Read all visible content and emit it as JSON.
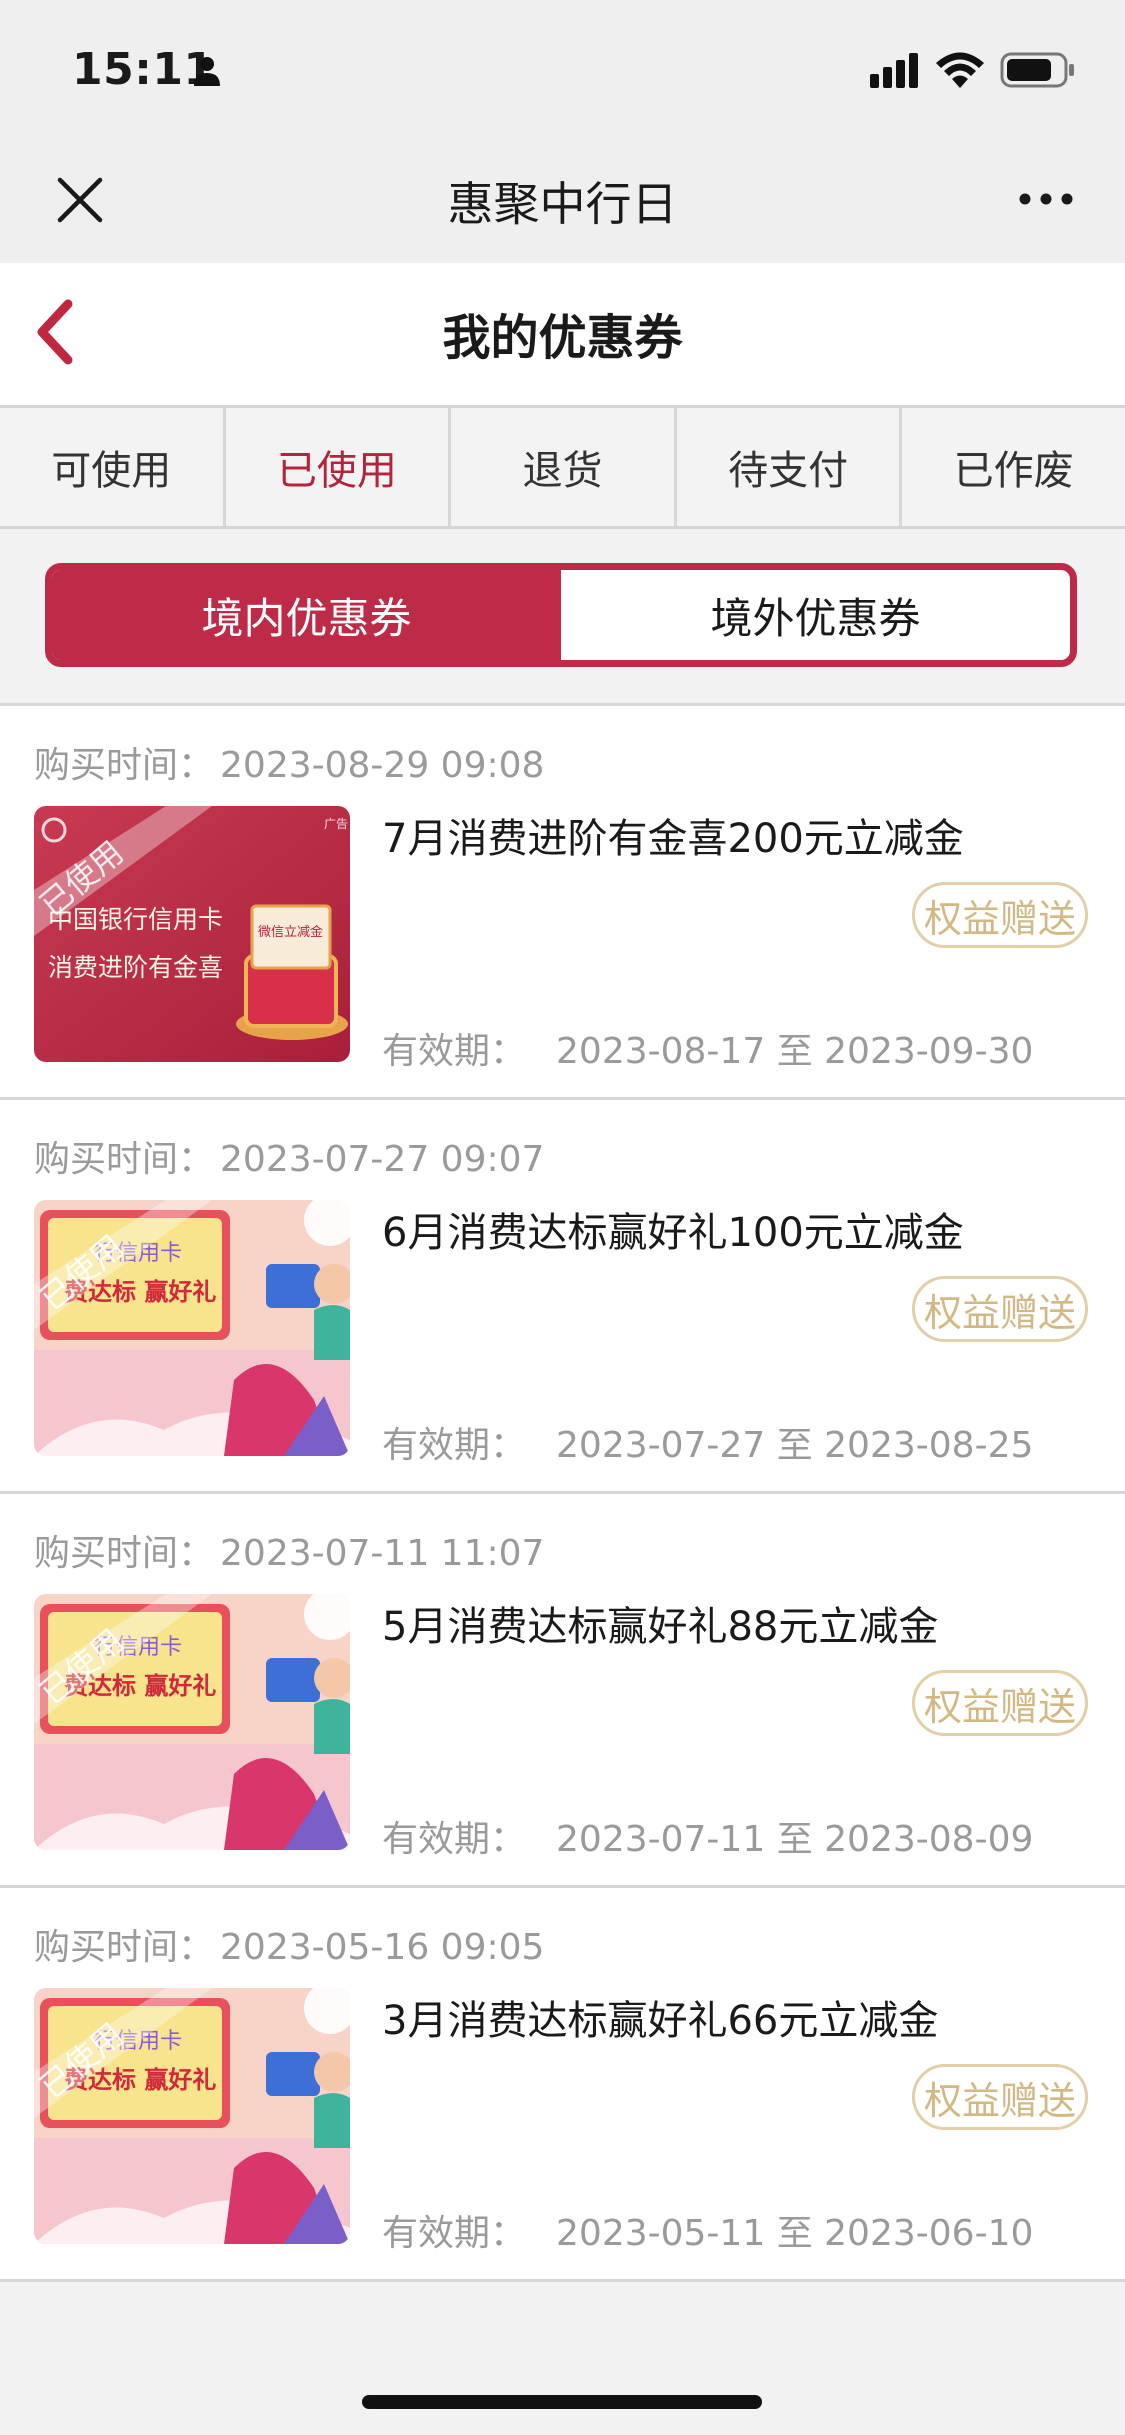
{
  "status_bar": {
    "time": "15:11"
  },
  "miniprogram": {
    "title": "惠聚中行日"
  },
  "nav": {
    "title": "我的优惠券"
  },
  "tabs": [
    {
      "label": "可使用"
    },
    {
      "label": "已使用"
    },
    {
      "label": "退货"
    },
    {
      "label": "待支付"
    },
    {
      "label": "已作废"
    }
  ],
  "active_tab": "已使用",
  "segment": {
    "domestic": "境内优惠券",
    "overseas": "境外优惠券"
  },
  "labels": {
    "purchase_time": "购买时间：",
    "validity": "有效期：",
    "to": "至",
    "used_stamp": "已使用"
  },
  "coupons": [
    {
      "purchase_time": "2023-08-29 09:08",
      "title": "7月消费进阶有金喜200元立减金",
      "badge": "权益赠送",
      "valid_from": "2023-08-17",
      "valid_to": "2023-09-30",
      "image": {
        "line1": "中国银行信用卡",
        "line2": "消费进阶有金喜",
        "tag": "广告",
        "box": "微信立减金"
      }
    },
    {
      "purchase_time": "2023-07-27 09:07",
      "title": "6月消费达标赢好礼100元立减金",
      "badge": "权益赠送",
      "valid_from": "2023-07-27",
      "valid_to": "2023-08-25",
      "image": {
        "line1": "行信用卡",
        "line2": "费达标 赢好礼"
      }
    },
    {
      "purchase_time": "2023-07-11 11:07",
      "title": "5月消费达标赢好礼88元立减金",
      "badge": "权益赠送",
      "valid_from": "2023-07-11",
      "valid_to": "2023-08-09",
      "image": {
        "line1": "行信用卡",
        "line2": "费达标 赢好礼"
      }
    },
    {
      "purchase_time": "2023-05-16 09:05",
      "title": "3月消费达标赢好礼66元立减金",
      "badge": "权益赠送",
      "valid_from": "2023-05-11",
      "valid_to": "2023-06-10",
      "image": {
        "line1": "行信用卡",
        "line2": "费达标 赢好礼"
      }
    }
  ],
  "colors": {
    "brand_red": "#be2b48",
    "active_tab_text": "#b3243d",
    "badge_gold": "#d2b884"
  }
}
